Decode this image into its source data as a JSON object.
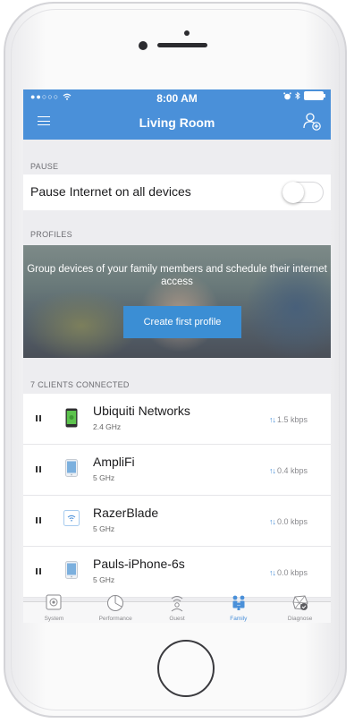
{
  "status_bar": {
    "signal": "●●○○○",
    "time": "8:00 AM"
  },
  "nav": {
    "title": "Living Room"
  },
  "pause_section": {
    "label": "PAUSE",
    "row_text": "Pause Internet on all devices",
    "toggle_state": "off"
  },
  "profiles_section": {
    "label": "PROFILES",
    "banner_text": "Group devices of your family members and schedule their internet access",
    "button_label": "Create first profile"
  },
  "clients_section": {
    "label": "7 CLIENTS CONNECTED",
    "clients": [
      {
        "name": "Ubiquiti Networks",
        "band": "2.4 GHz",
        "rate": "1.5 kbps",
        "icon": "android-phone-icon"
      },
      {
        "name": "AmpliFi",
        "band": "5 GHz",
        "rate": "0.4 kbps",
        "icon": "tablet-icon"
      },
      {
        "name": "RazerBlade",
        "band": "5 GHz",
        "rate": "0.0 kbps",
        "icon": "wifi-device-icon"
      },
      {
        "name": "Pauls-iPhone-6s",
        "band": "5 GHz",
        "rate": "0.0 kbps",
        "icon": "iphone-icon"
      }
    ]
  },
  "tabs": [
    {
      "label": "System",
      "icon": "router-icon"
    },
    {
      "label": "Performance",
      "icon": "pie-chart-icon"
    },
    {
      "label": "Guest",
      "icon": "guest-icon"
    },
    {
      "label": "Family",
      "icon": "family-icon",
      "active": true
    },
    {
      "label": "Diagnose",
      "icon": "diagnose-icon"
    }
  ],
  "colors": {
    "accent": "#4a90d9",
    "button": "#3b8ed4",
    "background": "#ededf0"
  }
}
